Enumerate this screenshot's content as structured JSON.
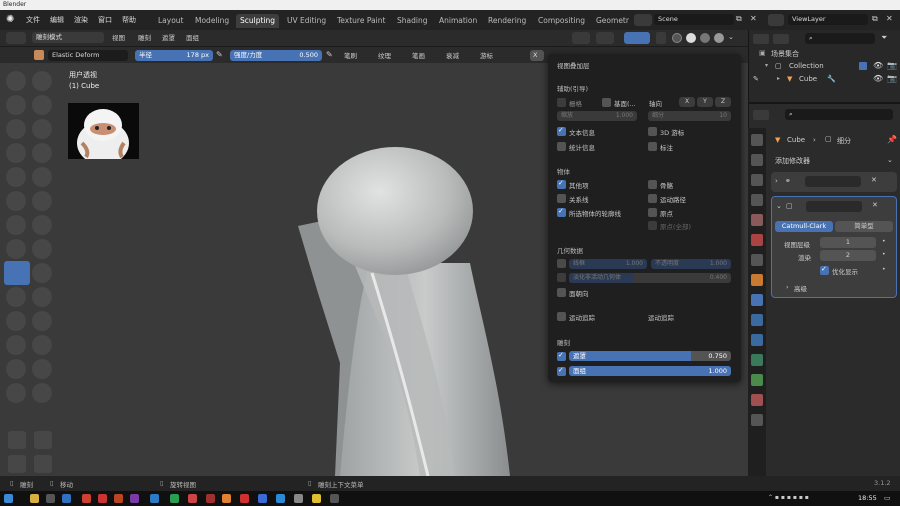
{
  "window": {
    "title": "Blender"
  },
  "menu": {
    "items": [
      "文件",
      "编辑",
      "渲染",
      "窗口",
      "帮助"
    ]
  },
  "workspaces": {
    "tabs": [
      "Layout",
      "Modeling",
      "Sculpting",
      "UV Editing",
      "Texture Paint",
      "Shading",
      "Animation",
      "Rendering",
      "Compositing",
      "Geometr"
    ],
    "active": "Sculpting"
  },
  "scene": {
    "label": "Scene"
  },
  "viewlayer": {
    "label": "ViewLayer"
  },
  "viewport_header": {
    "mode": "雕刻模式",
    "menus": [
      "视图",
      "雕刻",
      "遮罩",
      "面组"
    ]
  },
  "tool_header": {
    "brush_name": "Elastic Deform",
    "radius_label": "半径",
    "radius_value": "178 px",
    "strength_label": "强度/力度",
    "strength_value": "0.500",
    "dropdowns": [
      "笔刷",
      "纹理",
      "笔画",
      "衰减",
      "游标"
    ],
    "axis_x": "X"
  },
  "viewport": {
    "view_name": "用户透视",
    "object_name": "(1) Cube"
  },
  "overlay": {
    "title": "视图叠加层",
    "guides_header": "辅助(引导)",
    "grid_label": "栅格",
    "floor_label": "基面(...",
    "axis_label": "轴向",
    "axes": [
      "X",
      "Y",
      "Z"
    ],
    "scale_label": "缩放",
    "scale_value": "1.000",
    "subdiv_label": "细分",
    "subdiv_value": "10",
    "text_info": "文本信息",
    "cursor3d": "3D 游标",
    "stats": "统计信息",
    "annotations": "标注",
    "objects_header": "物体",
    "extras": "其他项",
    "bones": "骨骼",
    "relations": "关系线",
    "motion_paths": "运动路径",
    "outline_selected": "所选物体的轮廓线",
    "origins": "原点",
    "origins_all": "原点(全部)",
    "geometry_header": "几何数据",
    "wireframe": "线框",
    "wireframe_value": "1.000",
    "opacity": "不透明度",
    "opacity_value": "1.000",
    "fade_geometry": "淡化非活动几何体",
    "fade_value": "0.400",
    "face_orientation": "面朝向",
    "motion_tracking": "运动追踪",
    "motion_tracking2": "运动追踪",
    "sculpt_header": "雕刻",
    "mask_label": "遮罩",
    "mask_value": "0.750",
    "mask_fraction": 0.75,
    "facesets_label": "面组",
    "facesets_value": "1.000",
    "facesets_fraction": 1.0
  },
  "outliner": {
    "collection_root": "场景集合",
    "collection": "Collection",
    "object": "Cube"
  },
  "properties": {
    "object": "Cube",
    "modifier": "细分",
    "add_modifier": "添加修改器",
    "catmull": "Catmull-Clark",
    "simple": "简单型",
    "levels_viewport_label": "视图层级",
    "levels_viewport": "1",
    "render_label": "渲染",
    "render_value": "2",
    "optimal_display": "优化显示",
    "advanced": "高级"
  },
  "statusbar": {
    "item1": "雕刻",
    "item2": "移动",
    "item3": "旋转视图",
    "item4": "雕刻上下文菜单",
    "version": "3.1.2"
  },
  "taskbar": {
    "time": "18:55"
  },
  "colors": {
    "accent": "#4772b3",
    "bg": "#3a3a3a",
    "panel": "#1f1f1f"
  }
}
